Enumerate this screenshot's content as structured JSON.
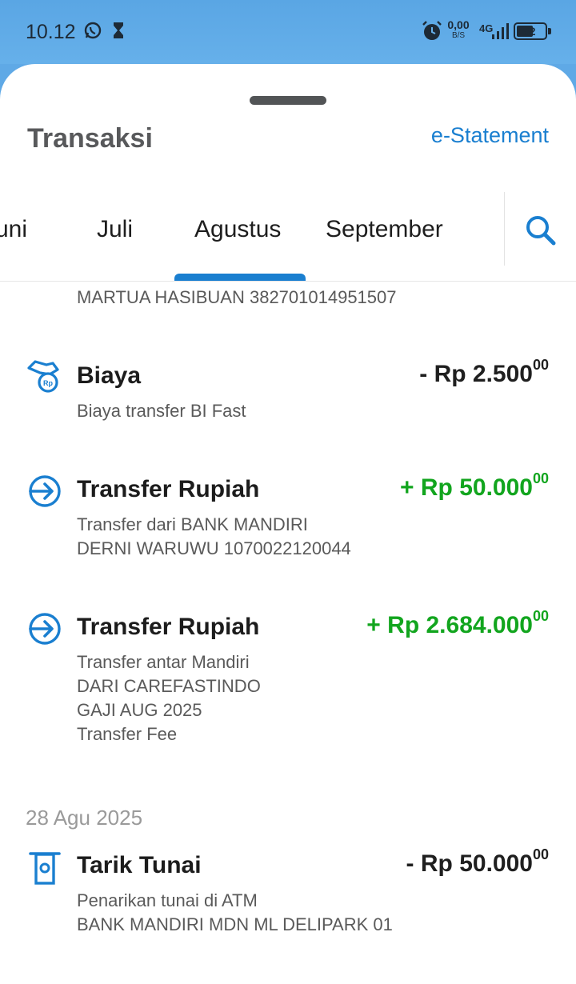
{
  "status_bar": {
    "time": "10.12",
    "net_speed": "0,00",
    "net_unit": "B/S",
    "network": "4G",
    "battery": "52"
  },
  "header": {
    "title": "Transaksi",
    "estatement_label": "e-Statement"
  },
  "tabs": [
    {
      "label": "Juni",
      "shown": "uni"
    },
    {
      "label": "Juli"
    },
    {
      "label": "Agustus",
      "active": true
    },
    {
      "label": "September"
    }
  ],
  "transactions_top": {
    "partial_line": "MARTUA HASIBUAN 382701014951507"
  },
  "transactions": [
    {
      "icon": "fee-icon",
      "title": "Biaya",
      "sign": "-",
      "amount": "Rp 2.500",
      "cents": "00",
      "lines": [
        "Biaya transfer BI Fast"
      ]
    },
    {
      "icon": "transfer-in-icon",
      "title": "Transfer Rupiah",
      "sign": "+",
      "amount": "Rp 50.000",
      "cents": "00",
      "lines": [
        "Transfer dari BANK MANDIRI",
        "DERNI WARUWU 1070022120044"
      ]
    },
    {
      "icon": "transfer-in-icon",
      "title": "Transfer Rupiah",
      "sign": "+",
      "amount": "Rp 2.684.000",
      "cents": "00",
      "lines": [
        "Transfer antar Mandiri",
        "DARI CAREFASTINDO",
        "GAJI AUG 2025",
        "Transfer Fee"
      ]
    }
  ],
  "date_group": {
    "date": "28 Agu 2025",
    "transaction": {
      "icon": "atm-icon",
      "title": "Tarik Tunai",
      "sign": "-",
      "amount": "Rp 50.000",
      "cents": "00",
      "lines": [
        "Penarikan tunai di ATM",
        "BANK MANDIRI MDN ML DELIPARK 01"
      ]
    }
  },
  "colors": {
    "accent": "#1a7fd0",
    "positive": "#12a51e",
    "status_bar": "#5fa9e6"
  }
}
